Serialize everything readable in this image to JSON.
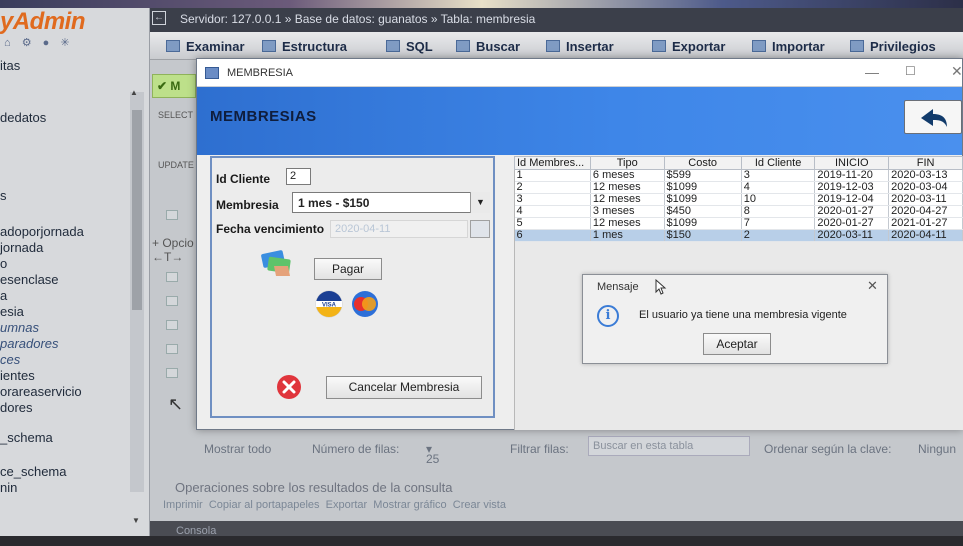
{
  "pma": {
    "logo": "yAdmin",
    "logo_icons": "⌂ ⚙ ● ✳",
    "sidebar_items": [
      {
        "label": "itas",
        "italic": false
      },
      {
        "label": "dedatos",
        "italic": false
      },
      {
        "label": "s",
        "italic": false
      },
      {
        "label": "adoporjornada",
        "italic": false
      },
      {
        "label": "jornada",
        "italic": false
      },
      {
        "label": "o",
        "italic": false
      },
      {
        "label": "esenclase",
        "italic": false
      },
      {
        "label": "a",
        "italic": false
      },
      {
        "label": "esia",
        "italic": false
      },
      {
        "label": "umnas",
        "italic": true
      },
      {
        "label": "paradores",
        "italic": true
      },
      {
        "label": "ces",
        "italic": true
      },
      {
        "label": "ientes",
        "italic": false
      },
      {
        "label": "orareaservicio",
        "italic": false
      },
      {
        "label": "dores",
        "italic": false
      },
      {
        "label": "_schema",
        "italic": false
      },
      {
        "label": "ce_schema",
        "italic": false
      },
      {
        "label": "nin",
        "italic": false
      }
    ],
    "breadcrumb": "Servidor: 127.0.0.1 »  Base de datos: guanatos »  Tabla: membresia",
    "tabs": [
      "Examinar",
      "Estructura",
      "SQL",
      "Buscar",
      "Insertar",
      "Exportar",
      "Importar",
      "Privilegios"
    ],
    "check_label": "M",
    "select_text": "SELECT",
    "update_text": "UPDATE",
    "opciones": "+ Opcio",
    "filter_bar": {
      "mostrar_todo": "Mostrar todo",
      "numero_filas": "Número de filas:",
      "rows_value": "25",
      "filtrar": "Filtrar filas:",
      "search_placeholder": "Buscar en esta tabla",
      "ordenar": "Ordenar según la clave:",
      "ninguna": "Ningun"
    },
    "ops_title": "Operaciones sobre los resultados de la consulta",
    "ops_links": "Imprimir   Copiar al portapapeles   Exportar   Mostrar gráfico   Crear vista",
    "console": "Consola"
  },
  "app": {
    "window_title": "MEMBRESIA",
    "banner_title": "MEMBRESIAS",
    "form": {
      "id_label": "Id Cliente",
      "id_value": "2",
      "membresia_label": "Membresia",
      "membresia_value": "1 mes - $150",
      "fecha_label": "Fecha vencimiento",
      "fecha_value": "2020-04-11",
      "pagar_label": "Pagar",
      "visa_text": "VISA",
      "cancel_label": "Cancelar Membresia"
    },
    "table": {
      "columns": [
        "Id Membres...",
        "Tipo",
        "Costo",
        "Id Cliente",
        "INICIO",
        "FIN"
      ],
      "rows": [
        [
          "1",
          "6 meses",
          "$599",
          "3",
          "2019-11-20",
          "2020-03-13"
        ],
        [
          "2",
          "12 meses",
          "$1099",
          "4",
          "2019-12-03",
          "2020-03-04"
        ],
        [
          "3",
          "12 meses",
          "$1099",
          "10",
          "2019-12-04",
          "2020-03-11"
        ],
        [
          "4",
          "3 meses",
          "$450",
          "8",
          "2020-01-27",
          "2020-04-27"
        ],
        [
          "5",
          "12 meses",
          "$1099",
          "7",
          "2020-01-27",
          "2021-01-27"
        ],
        [
          "6",
          "1 mes",
          "$150",
          "2",
          "2020-03-11",
          "2020-04-11"
        ]
      ],
      "selected_row": 5
    },
    "message": {
      "title": "Mensaje",
      "text": "El usuario ya tiene una membresia vigente",
      "ok_label": "Aceptar"
    }
  },
  "colors": {
    "banner": "#3e86e8",
    "selected_row": "#b8cfe8",
    "pma_logo": "#e06a1e"
  }
}
